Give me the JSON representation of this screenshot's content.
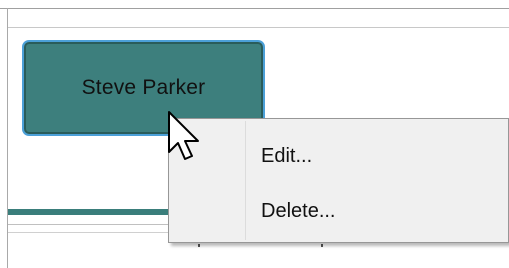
{
  "node": {
    "label": "Steve Parker",
    "fill_color": "#3d7f7d",
    "border_color": "#4ca0d8"
  },
  "context_menu": {
    "items": [
      {
        "label": "Edit..."
      },
      {
        "label": "Delete..."
      }
    ]
  },
  "cursor": {
    "icon": "arrow-pointer-icon"
  }
}
